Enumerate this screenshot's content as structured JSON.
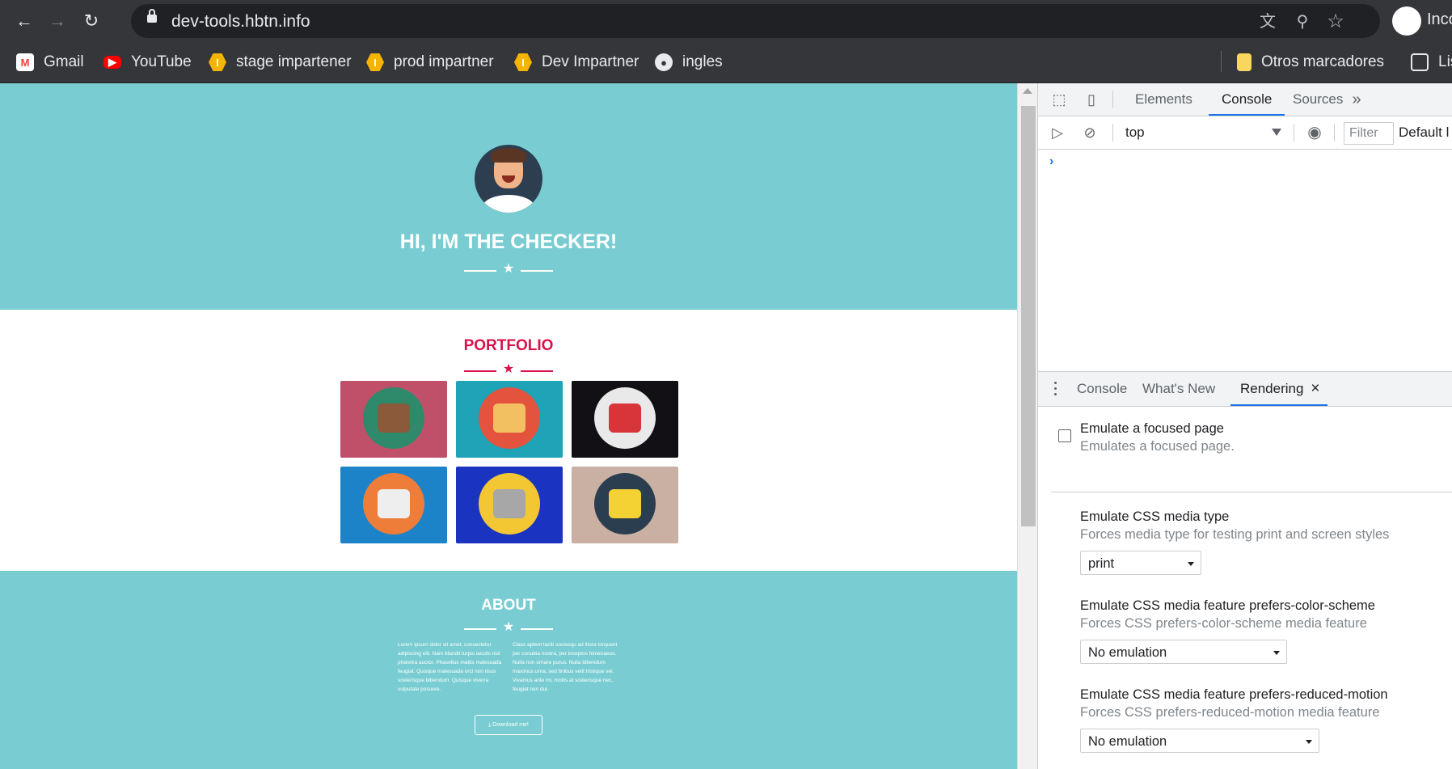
{
  "browser": {
    "url": "dev-tools.hbtn.info",
    "profile_label": "Incognito",
    "nav": {
      "back": "←",
      "forward": "→",
      "reload": "↻"
    },
    "omnibox_icons": {
      "translate": "文",
      "zoom": "⚲",
      "star": "☆"
    },
    "bookmarks": [
      {
        "label": "Gmail",
        "icon": "gmail-icon",
        "glyph": "M"
      },
      {
        "label": "YouTube",
        "icon": "youtube-icon",
        "glyph": "▶"
      },
      {
        "label": "stage impartener",
        "icon": "holberton-icon",
        "glyph": "I"
      },
      {
        "label": "prod impartner",
        "icon": "holberton-icon",
        "glyph": "I"
      },
      {
        "label": "Dev Impartner",
        "icon": "holberton-icon",
        "glyph": "I"
      },
      {
        "label": "ingles",
        "icon": "globe-icon",
        "glyph": "●"
      }
    ],
    "other_bookmarks": "Otros marcadores",
    "reading_list": "Lis"
  },
  "page": {
    "hero_title": "HI, I'M THE CHECKER!",
    "portfolio_title": "PORTFOLIO",
    "portfolio_items": [
      {
        "name": "cabin",
        "bg": "#c0506a",
        "circle": "#2f8a6b",
        "inner": "#8a5a3a"
      },
      {
        "name": "cake",
        "bg": "#1fa3b7",
        "circle": "#e3533e",
        "inner": "#f3c061"
      },
      {
        "name": "circus",
        "bg": "#121014",
        "circle": "#e9e9e9",
        "inner": "#d8353a"
      },
      {
        "name": "controller",
        "bg": "#1d83c8",
        "circle": "#ee7d3a",
        "inner": "#eeeeee"
      },
      {
        "name": "safe",
        "bg": "#1a34c1",
        "circle": "#f2c733",
        "inner": "#a7a7a7"
      },
      {
        "name": "submarine",
        "bg": "#c9b0a3",
        "circle": "#2b3e50",
        "inner": "#f4d234"
      }
    ],
    "about_title": "ABOUT",
    "about_left": "Lorem ipsum dolor sit amet, consectetur adipiscing elit. Nam blandit turpis iaculis nisl pharetra auctor. Phasellus mattis malesuada feugiat. Quisque malesuada orci non risus scelerisque bibendum. Quisque viverra vulputate posuere.",
    "about_right": "Class aptent taciti sociosqu ad litora torquent per conubia nostra, per inceptos himenaeos. Nulla non ornare purus. Nulla bibendum maximus urna, sed finibus velit tristique vel. Vivamus ante mi, mollis at scelerisque nec, feugiat non dui.",
    "download_label": "⤓ Download me!",
    "colors": {
      "teal": "#79cdd2",
      "accent": "#d9114a"
    }
  },
  "devtools": {
    "tabs": [
      "Elements",
      "Console",
      "Sources"
    ],
    "active_tab": "Console",
    "more_tabs": "»",
    "context": "top",
    "filter_placeholder": "Filter",
    "levels": "Default l",
    "prompt": "›",
    "drawer_tabs": [
      "Console",
      "What's New",
      "Rendering"
    ],
    "drawer_active": "Rendering",
    "close_glyph": "×",
    "rendering": {
      "focused_title": "Emulate a focused page",
      "focused_desc": "Emulates a focused page.",
      "media_type_title": "Emulate CSS media type",
      "media_type_desc": "Forces media type for testing print and screen styles",
      "media_type_value": "print",
      "color_scheme_title": "Emulate CSS media feature prefers-color-scheme",
      "color_scheme_desc": "Forces CSS prefers-color-scheme media feature",
      "color_scheme_value": "No emulation",
      "reduced_motion_title": "Emulate CSS media feature prefers-reduced-motion",
      "reduced_motion_desc": "Forces CSS prefers-reduced-motion media feature",
      "reduced_motion_value": "No emulation"
    }
  }
}
